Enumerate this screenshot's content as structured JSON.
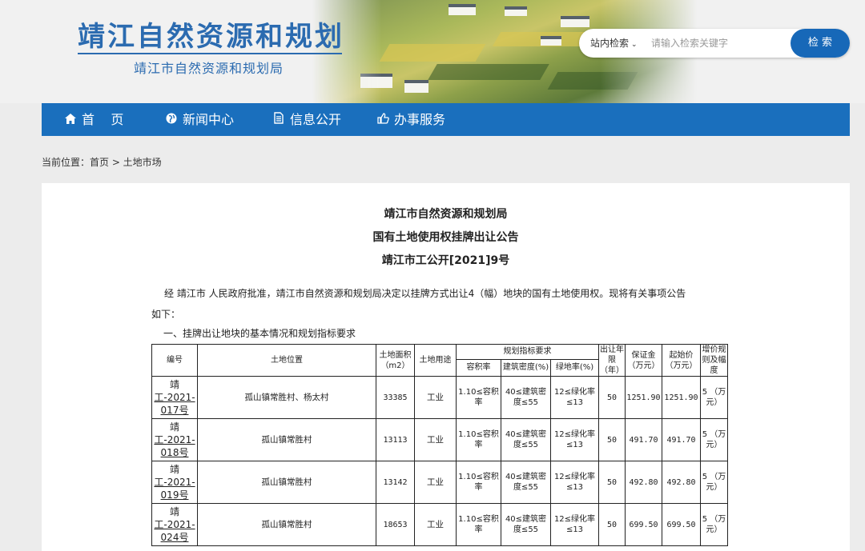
{
  "header": {
    "title": "靖江自然资源和规划",
    "subtitle": "靖江市自然资源和规划局"
  },
  "search": {
    "scope": "站内检索",
    "placeholder": "请输入检索关键字",
    "button": "检 索"
  },
  "nav": {
    "items": [
      {
        "icon": "home-icon",
        "label": "首    页"
      },
      {
        "icon": "globe-icon",
        "label": "新闻中心"
      },
      {
        "icon": "document-icon",
        "label": "信息公开"
      },
      {
        "icon": "thumbs-up-icon",
        "label": "办事服务"
      }
    ]
  },
  "breadcrumb": "当前位置：首页 > 土地市场",
  "article": {
    "line1": "靖江市自然资源和规划局",
    "line2": "国有土地使用权挂牌出让公告",
    "line3": "靖江市工公开[2021]9号",
    "intro_a": "经 靖江市 人民政府批准，靖江市自然资源和规划局决定以挂牌方式出让4（幅）地块的国有土地使用权。现将有关事项公告",
    "intro_b": "如下：",
    "section1": "一、挂牌出让地块的基本情况和规划指标要求"
  },
  "table": {
    "headers": {
      "id": "编号",
      "location": "土地位置",
      "area": "土地面积（m2）",
      "use": "土地用途",
      "planning": "规划指标要求",
      "far": "容积率",
      "density": "建筑密度(%)",
      "green": "绿地率(%)",
      "term": "出让年限（年）",
      "deposit": "保证金（万元）",
      "start": "起始价（万元）",
      "increment": "增价规则及幅度"
    },
    "rows": [
      {
        "id_a": "靖",
        "id_b": "工-2021-",
        "id_c": "017号",
        "location": "孤山镇常胜村、杨太村",
        "area": "33385",
        "use": "工业",
        "far": "1.10≤容积率",
        "density": "40≤建筑密度≤55",
        "green": "12≤绿化率≤13",
        "term": "50",
        "deposit": "1251.90",
        "start": "1251.90",
        "increment": "5 （万元）"
      },
      {
        "id_a": "靖",
        "id_b": "工-2021-",
        "id_c": "018号",
        "location": "孤山镇常胜村",
        "area": "13113",
        "use": "工业",
        "far": "1.10≤容积率",
        "density": "40≤建筑密度≤55",
        "green": "12≤绿化率≤13",
        "term": "50",
        "deposit": "491.70",
        "start": "491.70",
        "increment": "5 （万元）"
      },
      {
        "id_a": "靖",
        "id_b": "工-2021-",
        "id_c": "019号",
        "location": "孤山镇常胜村",
        "area": "13142",
        "use": "工业",
        "far": "1.10≤容积率",
        "density": "40≤建筑密度≤55",
        "green": "12≤绿化率≤13",
        "term": "50",
        "deposit": "492.80",
        "start": "492.80",
        "increment": "5 （万元）"
      },
      {
        "id_a": "靖",
        "id_b": "工-2021-",
        "id_c": "024号",
        "location": "孤山镇常胜村",
        "area": "18653",
        "use": "工业",
        "far": "1.10≤容积率",
        "density": "40≤建筑密度≤55",
        "green": "12≤绿化率≤13",
        "term": "50",
        "deposit": "699.50",
        "start": "699.50",
        "increment": "5 （万元）"
      }
    ]
  }
}
